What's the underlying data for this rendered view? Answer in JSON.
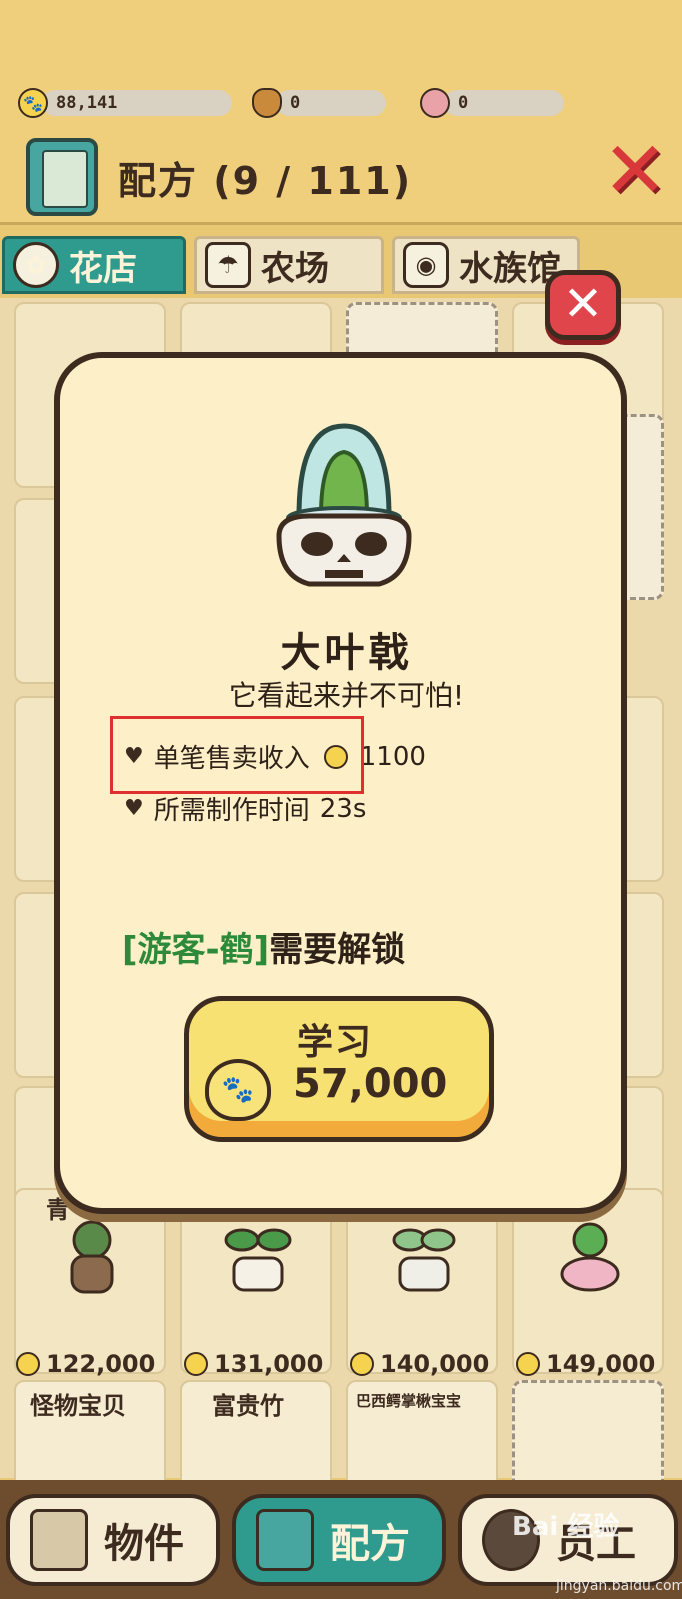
{
  "currencies": [
    {
      "icon": "coin-icon",
      "value": "88,141"
    },
    {
      "icon": "acorn-icon",
      "value": "0"
    },
    {
      "icon": "shell-icon",
      "value": "0"
    }
  ],
  "header": {
    "title": "配方 (9 / 111)",
    "close_symbol": "✕"
  },
  "tabs": [
    {
      "label": "花店",
      "icon": "flower-icon",
      "active": true
    },
    {
      "label": "农场",
      "icon": "watering-can-icon",
      "active": false
    },
    {
      "label": "水族馆",
      "icon": "fishbowl-icon",
      "active": false
    }
  ],
  "grid_items": [
    {
      "name": "青",
      "price": "122,000"
    },
    {
      "name": "",
      "price": "131,000"
    },
    {
      "name": "",
      "price": "140,000"
    },
    {
      "name": "",
      "price": "149,000"
    }
  ],
  "bottom_row_names": [
    "怪物宝贝",
    "富贵竹",
    "巴西鳄掌楸宝宝"
  ],
  "modal": {
    "close_symbol": "✕",
    "item_name": "大叶戟",
    "item_desc": "它看起来并不可怕!",
    "stats": [
      {
        "label": "单笔售卖收入",
        "value": "1100",
        "has_coin": true
      },
      {
        "label": "所需制作时间",
        "value": "23s",
        "has_coin": false
      }
    ],
    "unlock": {
      "who": "[游客-鹤]",
      "text": "需要解锁"
    },
    "learn_button": {
      "label": "学习",
      "price": "57,000"
    }
  },
  "nav": [
    {
      "label": "物件",
      "active": false
    },
    {
      "label": "配方",
      "active": true
    },
    {
      "label": "员工",
      "active": false
    }
  ],
  "watermark": {
    "brand": "Bai 经验",
    "url": "jingyan.baidu.com"
  },
  "colors": {
    "accent_teal": "#2e9b8e",
    "highlight_red": "#e02f2f",
    "unlock_green": "#2c8a3a",
    "button_yellow": "#f7e172"
  }
}
